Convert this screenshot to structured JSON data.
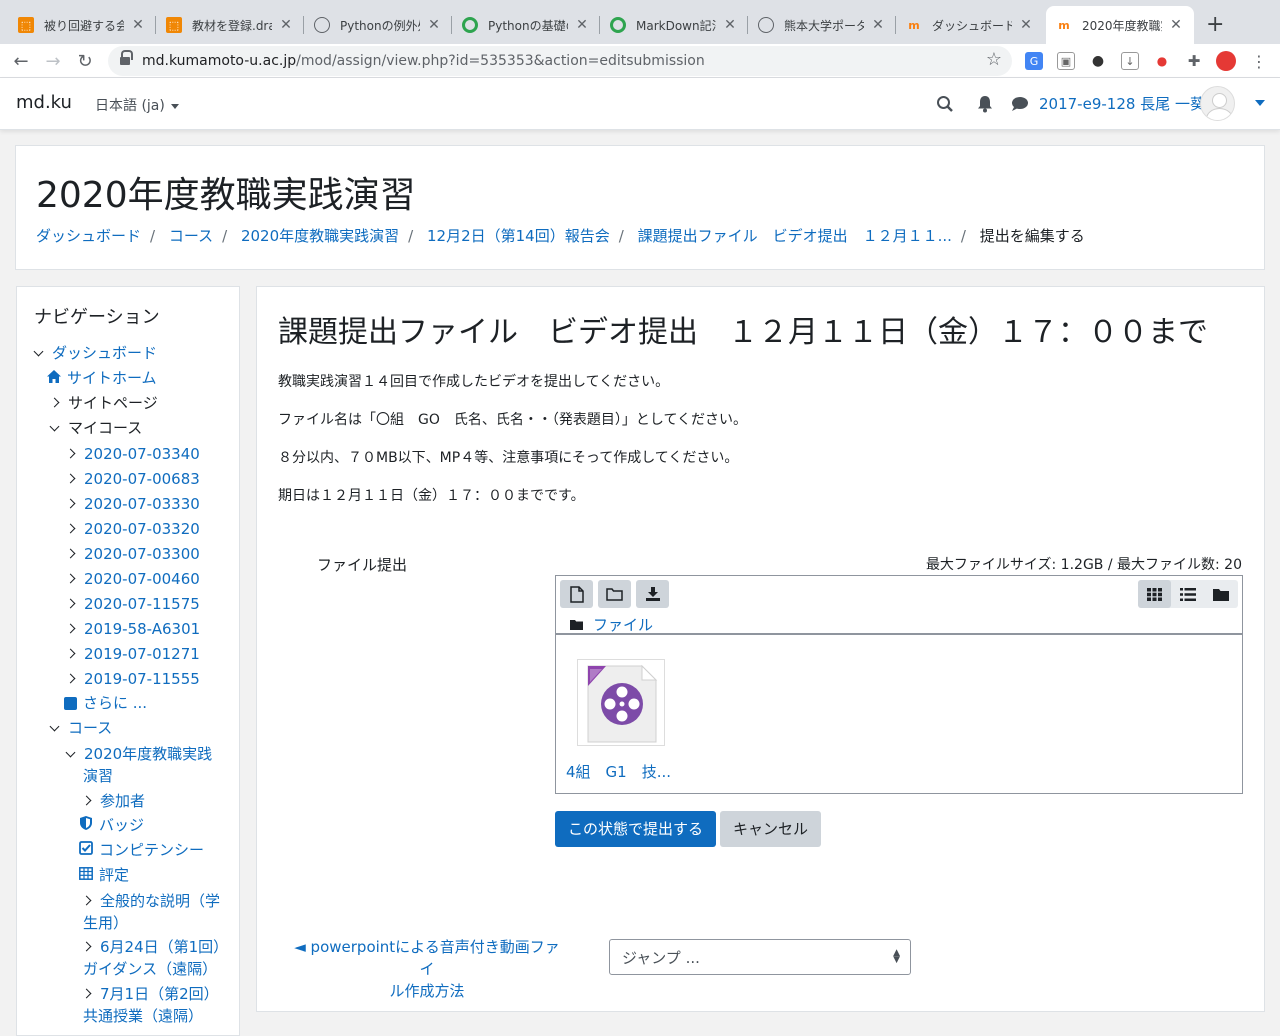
{
  "browser": {
    "tabs": [
      {
        "label": "被り回避する会",
        "icon": "drawio-icon"
      },
      {
        "label": "教材を登録.draw",
        "icon": "drawio-icon"
      },
      {
        "label": "Pythonの例外処",
        "icon": "globe-icon"
      },
      {
        "label": "Pythonの基礎の",
        "icon": "green-ring-icon"
      },
      {
        "label": "MarkDown記法",
        "icon": "green-ring-icon"
      },
      {
        "label": "熊本大学ポータル",
        "icon": "globe-icon"
      },
      {
        "label": "ダッシュボード",
        "icon": "moodle-icon"
      },
      {
        "label": "2020年度教職実",
        "icon": "moodle-icon",
        "active": true
      }
    ],
    "url_host": "md.kumamoto-u.ac.jp",
    "url_rest": "/mod/assign/view.php?id=535353&action=editsubmission"
  },
  "navbar": {
    "brand": "md.ku",
    "language": "日本語 (ja)",
    "user": "2017-e9-128 長尾 一葵"
  },
  "header": {
    "course_title": "2020年度教職実践演習",
    "breadcrumb": [
      "ダッシュボード",
      "コース",
      "2020年度教職実践演習",
      "12月2日（第14回）報告会",
      "課題提出ファイル　ビデオ提出　１２月１１...",
      "提出を編集する"
    ]
  },
  "nav": {
    "title": "ナビゲーション",
    "dashboard": "ダッシュボード",
    "site_home": "サイトホーム",
    "site_pages": "サイトページ",
    "my_courses": "マイコース",
    "courses": [
      "2020-07-03340",
      "2020-07-00683",
      "2020-07-03330",
      "2020-07-03320",
      "2020-07-03300",
      "2020-07-00460",
      "2020-07-11575",
      "2019-58-A6301",
      "2019-07-01271",
      "2019-07-11555"
    ],
    "more": "さらに ...",
    "course": "コース",
    "current_course_l1": "2020年度教職実践",
    "current_course_l2": "演習",
    "participants": "参加者",
    "badges": "バッジ",
    "competencies": "コンピテンシー",
    "grades": "評定",
    "general_l1": "全般的な説明（学",
    "general_l2": "生用）",
    "s1_l1": "6月24日（第1回）",
    "s1_l2": "ガイダンス（遠隔）",
    "s2_l1": "7月1日（第2回）",
    "s2_l2": "共通授業（遠隔）"
  },
  "assignment": {
    "title": "課題提出ファイル　ビデオ提出　１２月１１日（金）１７：００まで",
    "paragraphs": [
      "教職実践演習１４回目で作成したビデオを提出してください。",
      "ファイル名は「〇組　GO　氏名、氏名・・（発表題目）」としてください。",
      "８分以内、７０MB以下、MP４等、注意事項にそって作成してください。",
      "期日は１２月１１日（金）１７：００までです。"
    ],
    "file_label": "ファイル提出",
    "limits": "最大ファイルサイズ: 1.2GB / 最大ファイル数: 20",
    "path": "ファイル",
    "file_name": "4組　G1　技...",
    "submit": "この状態で提出する",
    "cancel": "キャンセル",
    "prev_link_l1": "◄ powerpointによる音声付き動画ファイ",
    "prev_link_l2": "ル作成方法",
    "jump": "ジャンプ ..."
  }
}
